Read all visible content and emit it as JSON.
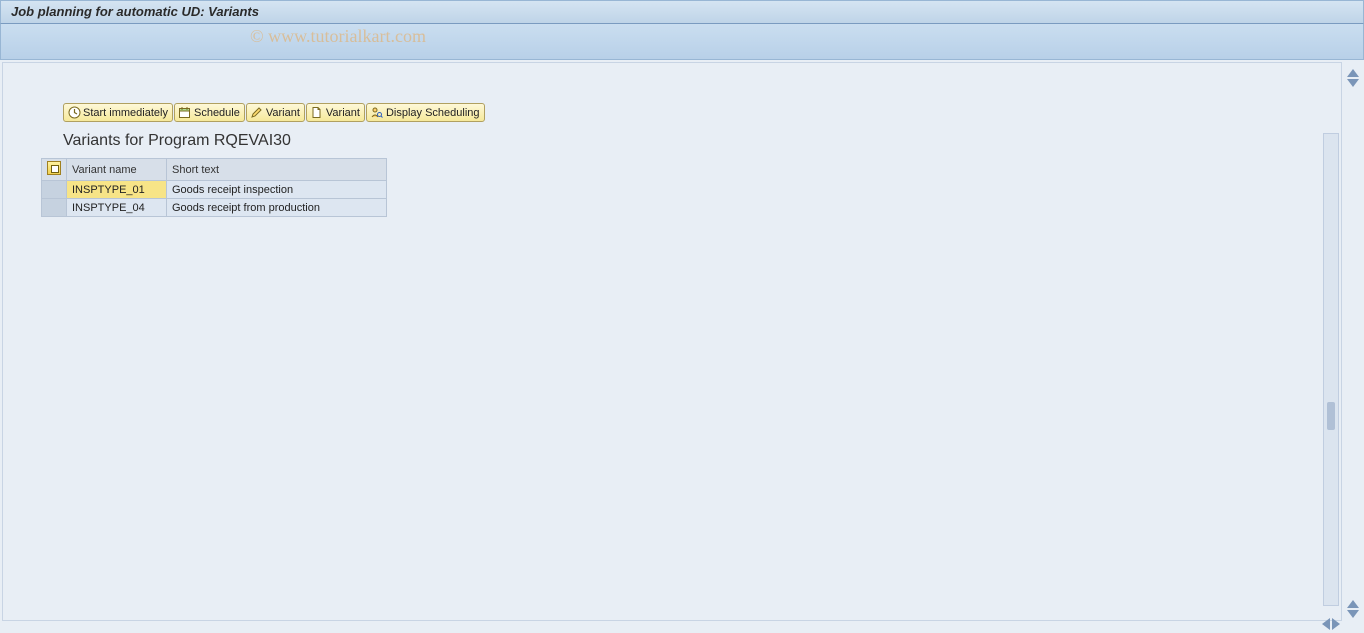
{
  "title": "Job planning for automatic UD: Variants",
  "watermark": "© www.tutorialkart.com",
  "toolbar": {
    "start_immediately": "Start immediately",
    "schedule": "Schedule",
    "variant_edit": "Variant",
    "variant_new": "Variant",
    "display_scheduling": "Display Scheduling"
  },
  "section_title": "Variants for Program RQEVAI30",
  "table": {
    "headers": {
      "variant_name": "Variant name",
      "short_text": "Short text"
    },
    "rows": [
      {
        "name": "INSPTYPE_01",
        "text": "Goods receipt inspection",
        "highlight": true
      },
      {
        "name": "INSPTYPE_04",
        "text": "Goods receipt from production",
        "highlight": false
      }
    ]
  }
}
